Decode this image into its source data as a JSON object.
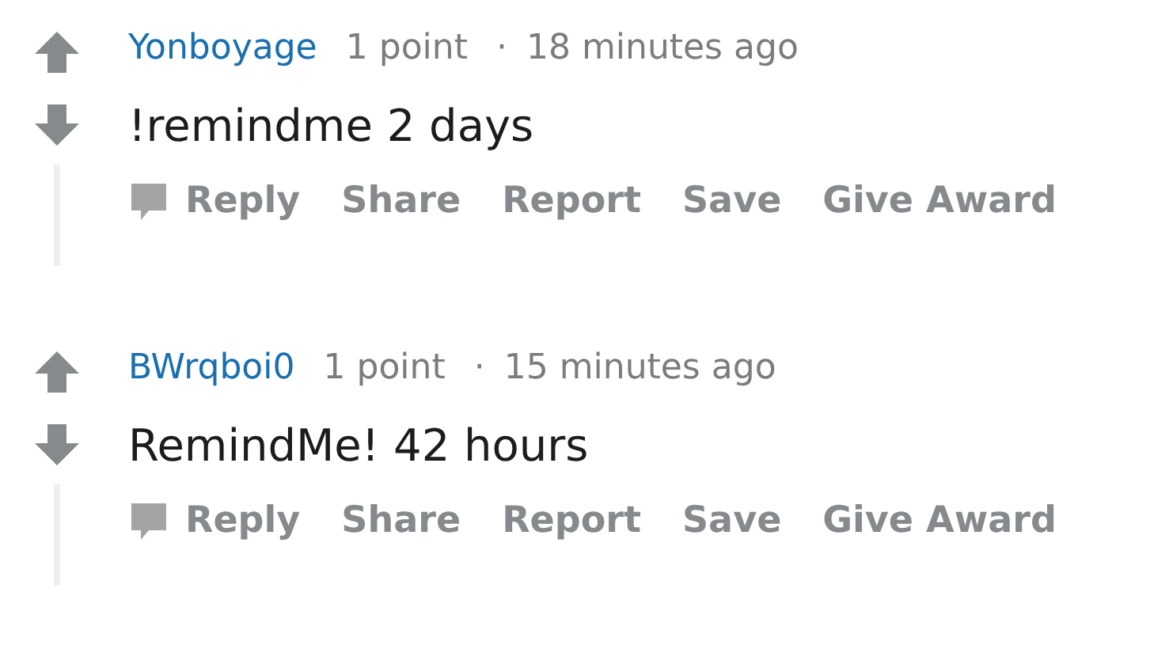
{
  "comments": [
    {
      "author": "Yonboyage",
      "score": "1 point",
      "separator": "·",
      "time": "18 minutes ago",
      "body": "!remindme 2 days",
      "actions": [
        "Reply",
        "Share",
        "Report",
        "Save",
        "Give Award"
      ]
    },
    {
      "author": "BWrqboi0",
      "score": "1 point",
      "separator": "·",
      "time": "15 minutes ago",
      "body": "RemindMe! 42 hours",
      "actions": [
        "Reply",
        "Share",
        "Report",
        "Save",
        "Give Award"
      ]
    }
  ]
}
